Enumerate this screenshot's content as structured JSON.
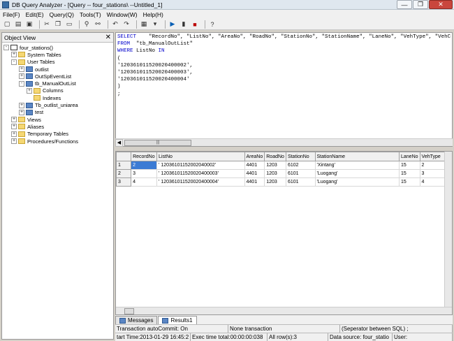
{
  "window": {
    "title": "DB Query Analyzer - [Query -- four_stations\\  --Untitled_1]",
    "btn_min": "—",
    "btn_max": "❐",
    "btn_close": "✕"
  },
  "menu": [
    "File(F)",
    "Edit(E)",
    "Query(Q)",
    "Tools(T)",
    "Window(W)",
    "Help(H)"
  ],
  "object_view": {
    "title": "Object View",
    "close": "✕",
    "tree": [
      {
        "label": "four_stations()",
        "level": 0,
        "exp": "-",
        "icon": "db"
      },
      {
        "label": "System Tables",
        "level": 1,
        "exp": "+",
        "icon": "folder"
      },
      {
        "label": "User Tables",
        "level": 1,
        "exp": "-",
        "icon": "folder"
      },
      {
        "label": "outlist",
        "level": 2,
        "exp": "+",
        "icon": "table"
      },
      {
        "label": "OutSpEventList",
        "level": 2,
        "exp": "+",
        "icon": "table"
      },
      {
        "label": "tb_ManualOutList",
        "level": 2,
        "exp": "-",
        "icon": "table"
      },
      {
        "label": "Columns",
        "level": 3,
        "exp": "+",
        "icon": "folder"
      },
      {
        "label": "Indexes",
        "level": 3,
        "exp": "",
        "icon": "folder"
      },
      {
        "label": "Tb_outlist_uniarea",
        "level": 2,
        "exp": "+",
        "icon": "table"
      },
      {
        "label": "test",
        "level": 2,
        "exp": "+",
        "icon": "table"
      },
      {
        "label": "Views",
        "level": 1,
        "exp": "+",
        "icon": "folder"
      },
      {
        "label": "Aliases",
        "level": 1,
        "exp": "+",
        "icon": "folder"
      },
      {
        "label": "Temporary Tables",
        "level": 1,
        "exp": "+",
        "icon": "folder"
      },
      {
        "label": "Procedures/Functions",
        "level": 1,
        "exp": "+",
        "icon": "folder"
      }
    ]
  },
  "editor": {
    "lines": [
      [
        {
          "k": 1,
          "t": "SELECT"
        },
        {
          "k": 0,
          "t": "    \"RecordNo\", \"ListNo\", \"AreaNo\", \"RoadNo\", \"StationNo\", \"StationName\", \"LaneNo\", \"VehType\", \"VehC"
        }
      ],
      [
        {
          "k": 1,
          "t": "FROM"
        },
        {
          "k": 0,
          "t": "  \"tb_ManualOutList\""
        }
      ],
      [
        {
          "k": 1,
          "t": "WHERE"
        },
        {
          "k": 0,
          "t": " ListNo "
        },
        {
          "k": 1,
          "t": "IN"
        }
      ],
      [
        {
          "k": 0,
          "t": "("
        }
      ],
      [
        {
          "k": 0,
          "t": "'120361011520020400002',"
        }
      ],
      [
        {
          "k": 0,
          "t": "'120361011520020400003',"
        }
      ],
      [
        {
          "k": 0,
          "t": "'120361011520020400004'"
        }
      ],
      [
        {
          "k": 0,
          "t": ")"
        }
      ],
      [
        {
          "k": 0,
          "t": ";"
        }
      ]
    ],
    "scroll_thumb": "|||"
  },
  "results": {
    "columns": [
      "",
      "RecordNo",
      "ListNo",
      "AreaNo",
      "RoadNo",
      "StationNo",
      "StationName",
      "LaneNo",
      "VehType",
      "V"
    ],
    "rows": [
      [
        "1",
        "2",
        "' 1203610115200204000​2'",
        "4401",
        "1203",
        "6102",
        "'Xintang'",
        "15",
        "2",
        "6"
      ],
      [
        "2",
        "3",
        "' 120361011520020400003'",
        "4401",
        "1203",
        "6101",
        "'Luogang'",
        "15",
        "3",
        "6"
      ],
      [
        "3",
        "4",
        "' 120361011520020400004'",
        "4401",
        "1203",
        "6101",
        "'Luogang'",
        "15",
        "4",
        "6"
      ]
    ]
  },
  "tabs": [
    "Messages",
    "Results1"
  ],
  "status": {
    "row1": [
      "Transaction autoCommit: On",
      "None transaction",
      "(Seperator between SQL)  ;"
    ],
    "row2": [
      "tart Time:2013-01-29 16:45:2",
      "Exec time total:00:00:00:038",
      "All row(s):3",
      "Data source: four_statio",
      "User:"
    ]
  }
}
